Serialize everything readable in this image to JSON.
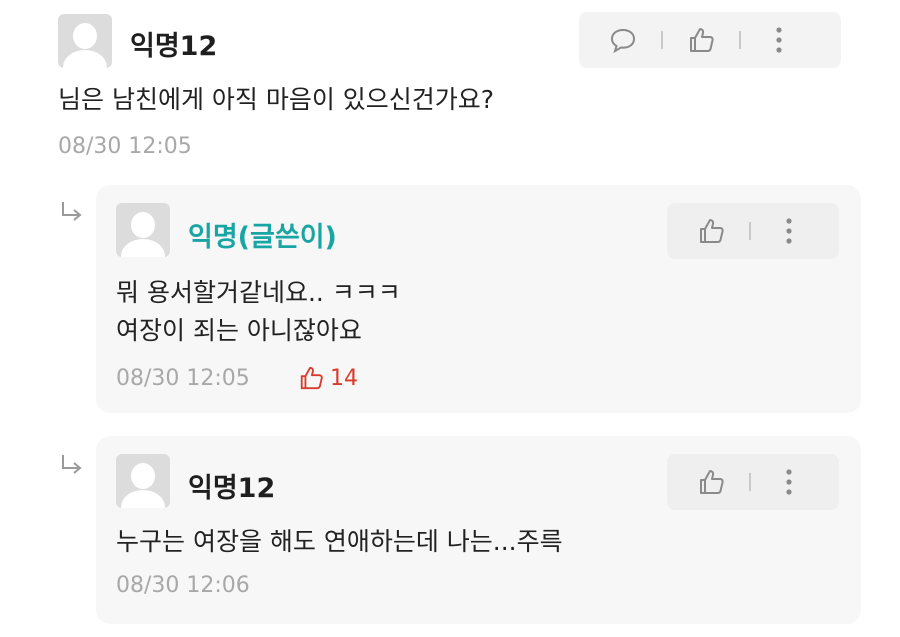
{
  "comment": {
    "author": "익명12",
    "text": "님은 남친에게 아직 마음이 있으신건가요?",
    "time": "08/30 12:05"
  },
  "replies": [
    {
      "author": "익명(글쓴이)",
      "is_author": true,
      "lines": [
        "뭐 용서할거같네요.. ㅋㅋㅋ",
        "여장이 죄는 아니잖아요"
      ],
      "time": "08/30 12:05",
      "like_count": "14"
    },
    {
      "author": "익명12",
      "is_author": false,
      "lines": [
        "누구는 여장을 해도 연애하는데 나는...주륵"
      ],
      "time": "08/30 12:06"
    }
  ],
  "colors": {
    "author_name": "#1aa5a5",
    "like_accent": "#d83b2b",
    "timestamp": "#a8a8a8"
  },
  "icons": [
    "avatar-placeholder-icon",
    "speech-bubble-icon",
    "thumbs-up-icon",
    "more-vertical-icon",
    "reply-arrow-icon"
  ]
}
